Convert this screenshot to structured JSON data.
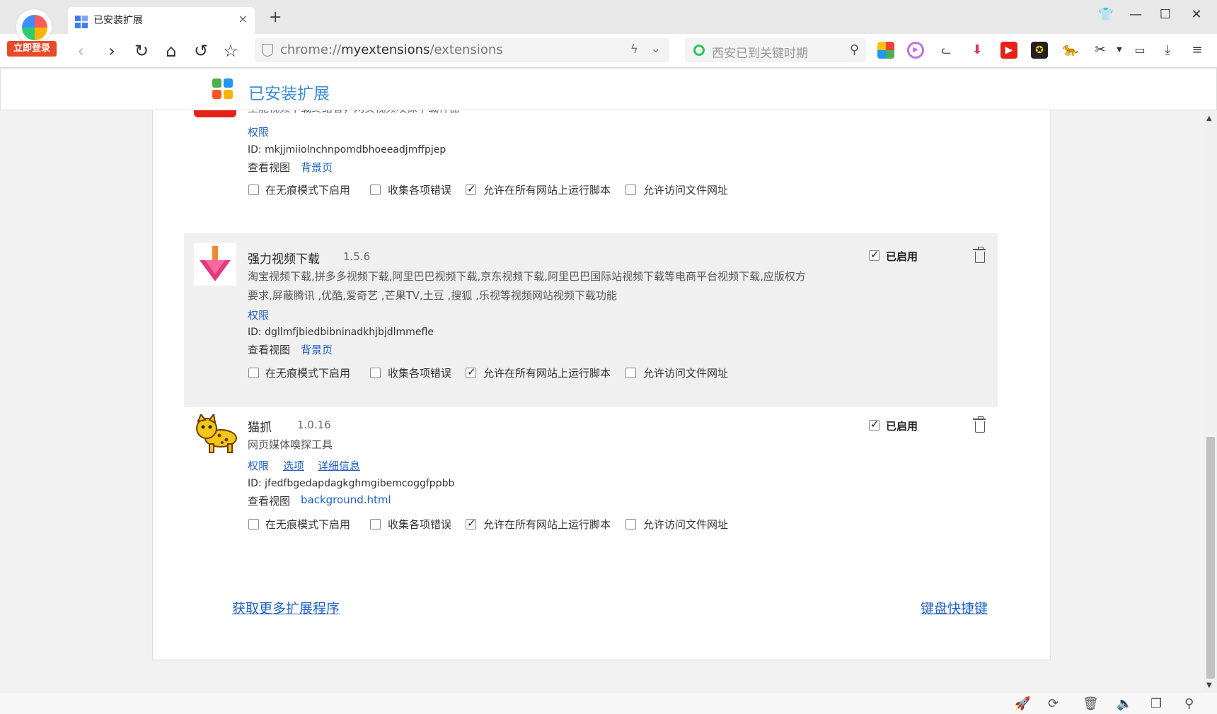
{
  "browser": {
    "login_label": "立即登录",
    "tab": {
      "title": "已安装扩展",
      "close": "×"
    },
    "new_tab": "+",
    "window_buttons": {
      "skin": "👕",
      "minimize": "—",
      "maximize": "☐",
      "close": "✕"
    },
    "nav": {
      "back": "‹",
      "forward": "›",
      "reload": "↻",
      "home": "⌂",
      "undo": "↺",
      "star": "☆"
    },
    "url": {
      "scheme": "chrome://",
      "host": "myextensions",
      "path": "/extensions"
    },
    "search": {
      "placeholder": "西安已到关键时期"
    },
    "toolbar_icons": [
      "apps-grid-icon",
      "video-play-icon",
      "cat-icon",
      "download-arrow-icon",
      "youtube-icon",
      "media-icon",
      "cheetah-icon",
      "scissors-icon",
      "battery-icon",
      "download-icon",
      "menu-icon"
    ]
  },
  "page": {
    "title": "已安装扩展",
    "logo_colors": [
      "#4caf50",
      "#2196f3",
      "#ff5722",
      "#f4b400"
    ]
  },
  "extensions": [
    {
      "description": "全能视频下载终结者，网页视频嗅探下载神器",
      "permissions": "权限",
      "id": "ID: mkjjmiiolnchnpomdbhoeeadjmffpjep",
      "view_label": "查看视图",
      "view_link": "背景页",
      "options": [
        {
          "label": "在无痕模式下启用",
          "checked": false
        },
        {
          "label": "收集各项错误",
          "checked": false
        },
        {
          "label": "允许在所有网站上运行脚本",
          "checked": true
        },
        {
          "label": "允许访问文件网址",
          "checked": false
        }
      ]
    },
    {
      "name": "强力视频下载",
      "version": "1.5.6",
      "description_line1": "淘宝视频下载,拼多多视频下载,阿里巴巴视频下载,京东视频下载,阿里巴巴国际站视频下载等电商平台视频下载,应版权方",
      "description_line2": "要求,屏蔽腾讯 ,优酷,爱奇艺 ,芒果TV,土豆 ,搜狐 ,乐视等视频网站视频下载功能",
      "permissions": "权限",
      "id": "ID: dgllmfjbiedbibninadkhjbjdlmmefle",
      "view_label": "查看视图",
      "view_link": "背景页",
      "enabled_label": "已启用",
      "options": [
        {
          "label": "在无痕模式下启用",
          "checked": false
        },
        {
          "label": "收集各项错误",
          "checked": false
        },
        {
          "label": "允许在所有网站上运行脚本",
          "checked": true
        },
        {
          "label": "允许访问文件网址",
          "checked": false
        }
      ]
    },
    {
      "name": "猫抓",
      "version": "1.0.16",
      "description": "网页媒体嗅探工具",
      "permissions": "权限",
      "options_link": "选项",
      "details_link": "详细信息",
      "id": "ID: jfedfbgedapdagkghmgibemcoggfppbb",
      "view_label": "查看视图",
      "view_link": "background.html",
      "enabled_label": "已启用",
      "options": [
        {
          "label": "在无痕模式下启用",
          "checked": false
        },
        {
          "label": "收集各项错误",
          "checked": false
        },
        {
          "label": "允许在所有网站上运行脚本",
          "checked": true
        },
        {
          "label": "允许访问文件网址",
          "checked": false
        }
      ]
    }
  ],
  "footer": {
    "more_extensions": "获取更多扩展程序",
    "shortcuts": "键盘快捷键"
  },
  "statusbar_icons": [
    "rocket-icon",
    "speed-icon",
    "trash-icon",
    "volume-icon",
    "window-icon",
    "search-icon"
  ]
}
